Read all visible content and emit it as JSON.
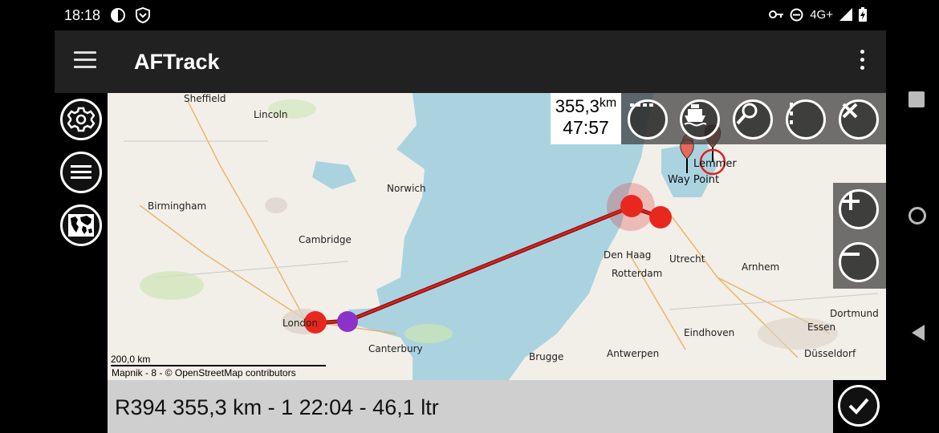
{
  "status": {
    "time": "18:18",
    "network": "4G+"
  },
  "app": {
    "title": "AFTrack"
  },
  "map": {
    "distance_value": "355,3",
    "distance_unit": "km",
    "duration": "47:57",
    "waypoint_label": "Way Point",
    "destination_label": "Lemmer",
    "scale": "200,0 km",
    "attribution": "Mapnik - 8 - © OpenStreetMap contributors",
    "places": [
      "Sheffield",
      "Lincoln",
      "Birmingham",
      "Cambridge",
      "Norwich",
      "London",
      "Canterbury",
      "Brugge",
      "Antwerpen",
      "Den Haag",
      "Rotterdam",
      "Eindhoven",
      "Utrecht",
      "Arnhem",
      "Essen",
      "Dortmund",
      "Düsseldorf"
    ]
  },
  "route": {
    "summary": "R394 355,3 km - 1 22:04 - 46,1 ltr"
  },
  "colors": {
    "route": "#e02020",
    "track_start": "#8b32c8",
    "land": "#f2efe9",
    "sea": "#aad3df"
  },
  "icons": {
    "settings": "gear-icon",
    "layers": "list-icon",
    "map": "world-map-icon",
    "dash": "dashed-line-icon",
    "boat": "boat-icon",
    "search": "search-icon",
    "more": "more-vert-icon",
    "close": "close-icon",
    "zoom_in": "plus-icon",
    "zoom_out": "minus-icon",
    "confirm": "check-icon"
  }
}
